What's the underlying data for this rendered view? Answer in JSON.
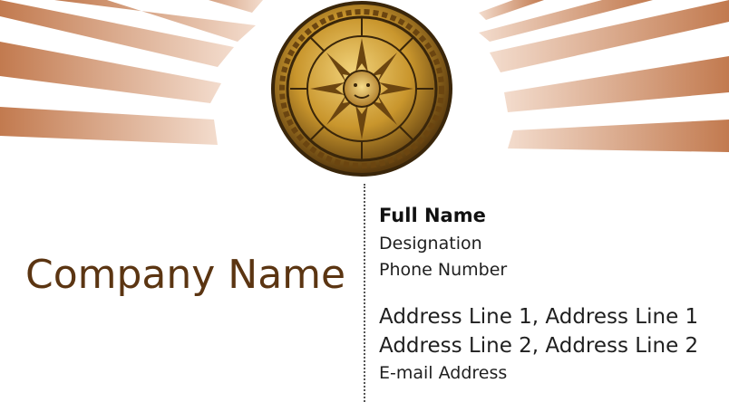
{
  "card": {
    "company_name": "Company Name",
    "full_name": "Full Name",
    "designation": "Designation",
    "phone": "Phone Number",
    "address_line_1": "Address Line 1,  Address Line 1",
    "address_line_2": "Address Line 2,  Address Line 2",
    "email": "E-mail Address"
  },
  "colors": {
    "ray_dark": "#c27a4f",
    "ray_light": "#f3dccd",
    "company_text": "#5b3512",
    "medallion_gold": "#c9962d"
  },
  "icons": {
    "emblem": "zodiac-sun-medallion-icon"
  }
}
